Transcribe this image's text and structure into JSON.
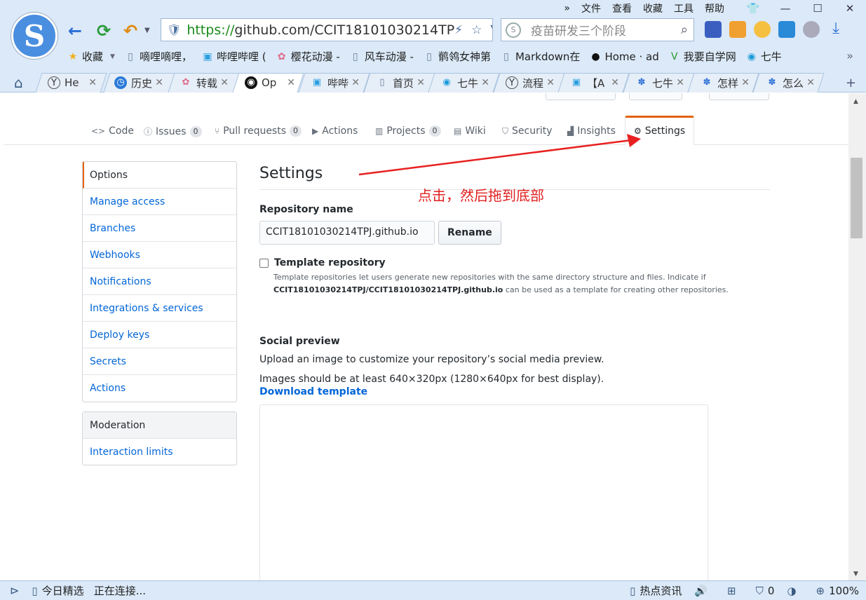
{
  "menu": [
    "文件",
    "查看",
    "收藏",
    "工具",
    "帮助"
  ],
  "addressbar": {
    "https": "https://",
    "domain": "github.com/CCIT18101030214TP"
  },
  "searchbox": {
    "placeholder": "疫苗研发三个阶段"
  },
  "favorites": [
    {
      "icon": "star-icon",
      "label": "收藏"
    },
    {
      "icon": "page-icon",
      "label": "嘀哩嘀哩，"
    },
    {
      "icon": "bilibili-icon",
      "label": "哔哩哔哩 ("
    },
    {
      "icon": "sakura-icon",
      "label": "樱花动漫 -"
    },
    {
      "icon": "page-icon",
      "label": "风车动漫 -"
    },
    {
      "icon": "page-icon",
      "label": "鹡鸰女神第"
    },
    {
      "icon": "page-icon",
      "label": "Markdown在"
    },
    {
      "icon": "github-icon",
      "label": "Home · ad"
    },
    {
      "icon": "vim-icon",
      "label": "我要自学网"
    },
    {
      "icon": "qiniu-icon",
      "label": "七牛"
    }
  ],
  "tabs": [
    {
      "label": "He",
      "active": false
    },
    {
      "label": "历史",
      "active": false
    },
    {
      "label": "转载",
      "active": false
    },
    {
      "label": "Op",
      "active": true
    },
    {
      "label": "哔哔",
      "active": false
    },
    {
      "label": "首页",
      "active": false
    },
    {
      "label": "七牛",
      "active": false
    },
    {
      "label": "流程",
      "active": false
    },
    {
      "label": "【A",
      "active": false
    },
    {
      "label": "七牛",
      "active": false
    },
    {
      "label": "怎样",
      "active": false
    },
    {
      "label": "怎么",
      "active": false
    }
  ],
  "reponav": {
    "code": "Code",
    "issues": "Issues",
    "issues_count": "0",
    "pulls": "Pull requests",
    "pulls_count": "0",
    "actions": "Actions",
    "projects": "Projects",
    "projects_count": "0",
    "wiki": "Wiki",
    "security": "Security",
    "insights": "Insights",
    "settings": "Settings"
  },
  "sidebar": {
    "items": [
      "Options",
      "Manage access",
      "Branches",
      "Webhooks",
      "Notifications",
      "Integrations & services",
      "Deploy keys",
      "Secrets",
      "Actions"
    ],
    "moderation_header": "Moderation",
    "moderation_items": [
      "Interaction limits"
    ]
  },
  "main": {
    "title": "Settings",
    "annotation": "点击，然后拖到底部",
    "repo_name_label": "Repository name",
    "repo_name_value": "CCIT18101030214TPJ.github.io",
    "rename_button": "Rename",
    "template_label": "Template repository",
    "template_note_1": "Template repositories let users generate new repositories with the same directory structure and files. Indicate if",
    "template_note_repo": "CCIT18101030214TPJ/CCIT18101030214TPJ.github.io",
    "template_note_2": " can be used as a template for creating other repositories.",
    "social_title": "Social preview",
    "social_desc": "Upload an image to customize your repository’s social media preview.",
    "social_size": "Images should be at least 640×320px (1280×640px for best display).",
    "download_template": "Download template"
  },
  "status": {
    "today": "今日精选",
    "connecting": "正在连接...",
    "hot": "热点资讯",
    "shield_count": "0",
    "zoom": "100%"
  },
  "colors": {
    "accent": "#e36209",
    "link": "#0366d6",
    "annotation": "#e02020",
    "browser_chrome": "#dbe9f8"
  }
}
